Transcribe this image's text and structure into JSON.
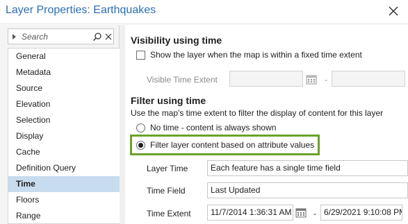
{
  "window": {
    "title": "Layer Properties: Earthquakes",
    "close_icon": "close-icon"
  },
  "sidebar": {
    "search_placeholder": "Search",
    "search_icon": "search-icon",
    "clear_icon": "clear-icon",
    "items": [
      {
        "label": "General"
      },
      {
        "label": "Metadata"
      },
      {
        "label": "Source"
      },
      {
        "label": "Elevation"
      },
      {
        "label": "Selection"
      },
      {
        "label": "Display"
      },
      {
        "label": "Cache"
      },
      {
        "label": "Definition Query"
      },
      {
        "label": "Time",
        "selected": true
      },
      {
        "label": "Floors"
      },
      {
        "label": "Range"
      }
    ]
  },
  "visibility": {
    "heading": "Visibility using time",
    "checkbox_label": "Show the layer when the map is within a fixed time extent",
    "checkbox_checked": false,
    "extent_label": "Visible Time Extent",
    "extent_start": "",
    "extent_end": "",
    "separator": "-"
  },
  "filter": {
    "heading": "Filter using time",
    "description": "Use the map's time extent to filter the display of content for this layer",
    "option_none": "No time - content is always shown",
    "option_attr": "Filter layer content based on attribute values",
    "selected_option": "attr",
    "layer_time_label": "Layer Time",
    "layer_time_value": "Each feature has a single time field",
    "time_field_label": "Time Field",
    "time_field_value": "Last Updated",
    "time_extent_label": "Time Extent",
    "time_extent_start": "11/7/2014 1:36:31 AM",
    "time_extent_end": "6/29/2021 9:10:08 PM",
    "separator": "-"
  },
  "colors": {
    "title": "#2b6fb3",
    "selected_nav": "#c8dcef",
    "highlight_border": "#6aa12a"
  }
}
